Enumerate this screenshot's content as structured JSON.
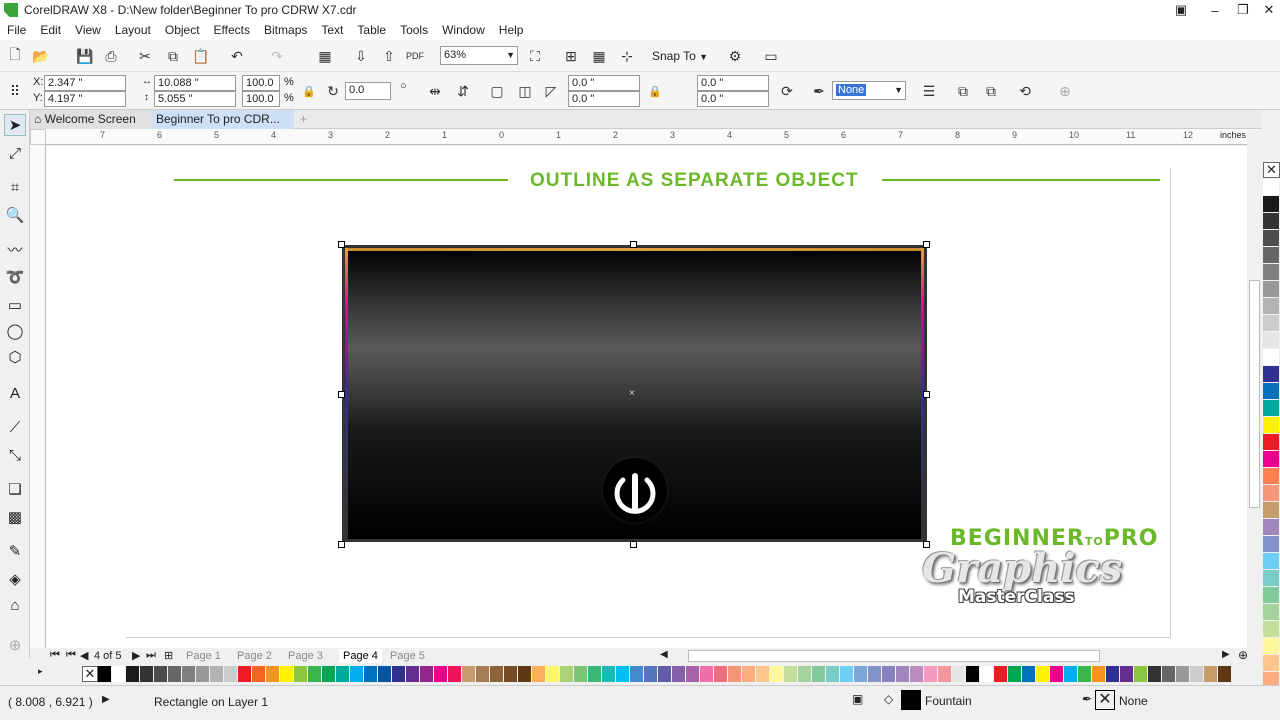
{
  "window": {
    "title": "CorelDRAW X8 - D:\\New folder\\Beginner To pro CDRW X7.cdr"
  },
  "menu": [
    "File",
    "Edit",
    "View",
    "Layout",
    "Object",
    "Effects",
    "Bitmaps",
    "Text",
    "Table",
    "Tools",
    "Window",
    "Help"
  ],
  "toolbar": {
    "zoom": "63%",
    "snap_to": "Snap To"
  },
  "props": {
    "x_label": "X:",
    "x_value": "2.347 \"",
    "y_label": "Y:",
    "y_value": "4.197 \"",
    "width_value": "10.088 \"",
    "height_value": "5.055 \"",
    "scale_x": "100.0",
    "scale_y": "100.0",
    "pct": "%",
    "rotation": "0.0",
    "corner_tl": "0.0 \"",
    "corner_bl": "0.0 \"",
    "corner_tr": "0.0 \"",
    "corner_br": "0.0 \"",
    "outline": "None"
  },
  "tabs": {
    "welcome": "Welcome Screen",
    "document": "Beginner To pro CDR..."
  },
  "ruler": {
    "ticks": [
      "7",
      "6",
      "5",
      "4",
      "3",
      "2",
      "1",
      "0",
      "1",
      "2",
      "3",
      "4",
      "5",
      "6",
      "7",
      "8",
      "9",
      "10",
      "11",
      "12"
    ],
    "unit": "inches"
  },
  "canvas": {
    "heading": "OUTLINE AS SEPARATE OBJECT"
  },
  "watermark": {
    "line1a": "BEGINNER",
    "line1b": "TO",
    "line1c": "PRO",
    "line2": "Graphics",
    "line3": "MasterClass"
  },
  "pages": {
    "counter": "4 of 5",
    "items": [
      "Page 1",
      "Page 2",
      "Page 3",
      "Page 4",
      "Page 5"
    ],
    "active": "Page 4"
  },
  "status": {
    "coords": "( 8.008 , 6.921 )",
    "object": "Rectangle on Layer 1",
    "fill": "Fountain",
    "outline": "None"
  },
  "colors": {
    "accent_green": "#6bb82a",
    "vertical_palette": [
      "#ffffff",
      "#1a1a1a",
      "#333333",
      "#4d4d4d",
      "#666666",
      "#808080",
      "#999999",
      "#b3b3b3",
      "#cccccc",
      "#e6e6e6",
      "#ffffff",
      "#2e3192",
      "#0072bc",
      "#00a99d",
      "#fff200",
      "#ed1c24",
      "#ec008c",
      "#ff7f50",
      "#f7977a",
      "#c69c6d",
      "#a186be",
      "#8393ca",
      "#6dcff6",
      "#7accc8",
      "#82ca9c",
      "#a3d39c",
      "#c4df9b",
      "#fff799",
      "#fdc68a",
      "#f9ad81",
      "#f5989d"
    ],
    "bottom_palette": [
      "#000000",
      "#ffffff",
      "#1a1a1a",
      "#333333",
      "#4d4d4d",
      "#666666",
      "#808080",
      "#999999",
      "#b3b3b3",
      "#cccccc",
      "#ed1c24",
      "#f26522",
      "#f7941d",
      "#fff200",
      "#8dc63f",
      "#39b54a",
      "#00a651",
      "#00a99d",
      "#00aeef",
      "#0072bc",
      "#0054a6",
      "#2e3192",
      "#662d91",
      "#92278f",
      "#ec008c",
      "#ed145b",
      "#c69c6d",
      "#a67c52",
      "#8c6239",
      "#754c24",
      "#603913",
      "#fbaf5d",
      "#fff568",
      "#acd373",
      "#7cc576",
      "#3bb878",
      "#1abbb4",
      "#00bff3",
      "#438ccb",
      "#5574b9",
      "#605ca8",
      "#855fa8",
      "#a763a8",
      "#f06ea9",
      "#f26d7d",
      "#f69679",
      "#f9ad81",
      "#fdc68a",
      "#fff799",
      "#c4df9b",
      "#a3d39c",
      "#82ca9c",
      "#7accc8",
      "#6dcff6",
      "#7da7d9",
      "#8393ca",
      "#8781bd",
      "#a186be",
      "#bd8cbf",
      "#f49ac1",
      "#f5989d",
      "#e6e6e6",
      "#000000",
      "#ffffff",
      "#ed1c24",
      "#00a651",
      "#0072bc",
      "#fff200",
      "#ec008c",
      "#00aeef",
      "#39b54a",
      "#f7941d",
      "#2e3192",
      "#662d91",
      "#8dc63f",
      "#333333",
      "#666666",
      "#999999",
      "#cccccc",
      "#c69c6d",
      "#603913"
    ]
  }
}
